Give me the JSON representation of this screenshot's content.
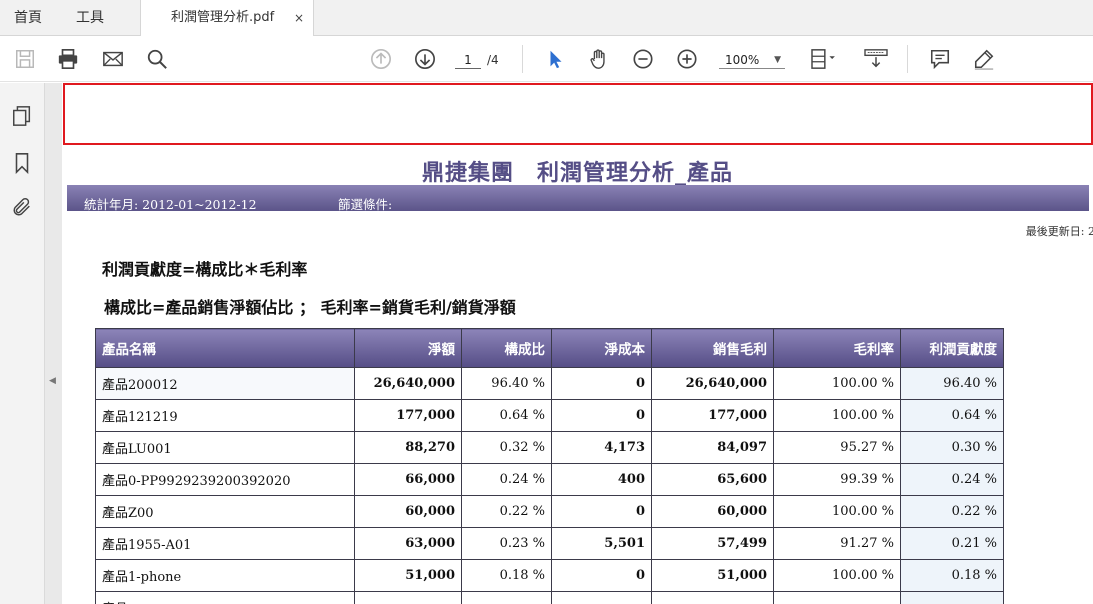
{
  "tabs": {
    "home": "首頁",
    "tools": "工具",
    "document": "利潤管理分析.pdf",
    "close": "×"
  },
  "toolbar": {
    "current_page": "1",
    "total_pages": "/4",
    "zoom": "100%",
    "icons": [
      "save-icon",
      "print-icon",
      "email-icon",
      "search-icon",
      "page-up-icon",
      "page-down-icon",
      "select-cursor-icon",
      "hand-icon",
      "zoom-out-icon",
      "zoom-in-icon",
      "page-fit-icon",
      "scroll-mode-icon",
      "comment-icon",
      "sign-icon"
    ]
  },
  "sidebar": {
    "icons": [
      "pages-icon",
      "bookmark-icon",
      "attachment-icon"
    ]
  },
  "colors": {
    "header_purple": "#554d86",
    "title_purple": "#554e86",
    "highlight_red": "#e0191f"
  },
  "report": {
    "title": "鼎捷集團　利潤管理分析_產品",
    "period_label": "統計年月: 2012-01~2012-12",
    "filter_label": "篩選條件:",
    "updated_label": "最後更新日: 2",
    "formula1": "利潤貢獻度=構成比＊毛利率",
    "formula2": "構成比=產品銷售淨額佔比 ； 毛利率=銷貨毛利/銷貨淨額",
    "columns": [
      "產品名稱",
      "淨額",
      "構成比",
      "淨成本",
      "銷售毛利",
      "毛利率",
      "利潤貢獻度"
    ],
    "rows": [
      {
        "name": "產品200012",
        "net": "26,640,000",
        "ratio": "96.40 %",
        "cost": "0",
        "gross": "26,640,000",
        "margin": "100.00 %",
        "contrib": "96.40 %"
      },
      {
        "name": "產品121219",
        "net": "177,000",
        "ratio": "0.64 %",
        "cost": "0",
        "gross": "177,000",
        "margin": "100.00 %",
        "contrib": "0.64 %"
      },
      {
        "name": "產品LU001",
        "net": "88,270",
        "ratio": "0.32 %",
        "cost": "4,173",
        "gross": "84,097",
        "margin": "95.27 %",
        "contrib": "0.30 %"
      },
      {
        "name": "產品0-PP9929239200392020",
        "net": "66,000",
        "ratio": "0.24 %",
        "cost": "400",
        "gross": "65,600",
        "margin": "99.39 %",
        "contrib": "0.24 %"
      },
      {
        "name": "產品Z00",
        "net": "60,000",
        "ratio": "0.22 %",
        "cost": "0",
        "gross": "60,000",
        "margin": "100.00 %",
        "contrib": "0.22 %"
      },
      {
        "name": "產品1955-A01",
        "net": "63,000",
        "ratio": "0.23 %",
        "cost": "5,501",
        "gross": "57,499",
        "margin": "91.27 %",
        "contrib": "0.21 %"
      },
      {
        "name": "產品1-phone",
        "net": "51,000",
        "ratio": "0.18 %",
        "cost": "0",
        "gross": "51,000",
        "margin": "100.00 %",
        "contrib": "0.18 %"
      },
      {
        "name": "產品",
        "net": "",
        "ratio": "",
        "cost": "",
        "gross": "",
        "margin": "",
        "contrib": ""
      }
    ]
  }
}
